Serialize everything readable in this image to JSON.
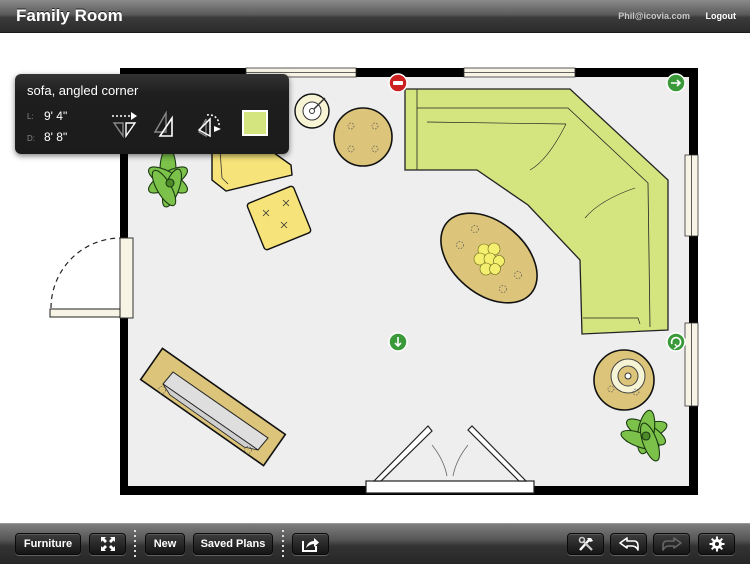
{
  "header": {
    "title": "Family Room",
    "user_email": "Phil@icovia.com",
    "logout_label": "Logout"
  },
  "selection_popup": {
    "item_name": "sofa, angled corner",
    "length_label": "L:",
    "length_value": "9' 4\"",
    "depth_label": "D:",
    "depth_value": "8' 8\"",
    "tools": [
      "flip-horizontal-icon",
      "mirror-icon",
      "rotate-icon",
      "color-swatch"
    ],
    "selected_color": "#d4e47f"
  },
  "floor_plan": {
    "room_name": "Family Room",
    "selection_handles": [
      "delete-handle",
      "resize-width-handle",
      "resize-depth-handle",
      "rotate-handle"
    ],
    "furniture": [
      {
        "name": "sofa, angled corner",
        "selected": true
      },
      {
        "name": "coffee table, oval"
      },
      {
        "name": "end table, round",
        "position": "top"
      },
      {
        "name": "end table with lamp, round",
        "position": "bottom-right"
      },
      {
        "name": "floor lamp"
      },
      {
        "name": "armchair"
      },
      {
        "name": "ottoman"
      },
      {
        "name": "plant",
        "position": "top-left"
      },
      {
        "name": "plant",
        "position": "bottom-right"
      },
      {
        "name": "tv console"
      }
    ],
    "colors": {
      "wall": "#000000",
      "floor": "#eeeeee",
      "sofa": "#d4e47f",
      "wood_table": "#dcc57a",
      "yellow_chair": "#f6e37a",
      "plant": "#7cc24a",
      "window": "#f7f4e6",
      "handle_red": "#cc1f1f",
      "handle_green": "#3a9a3a"
    }
  },
  "toolbar": {
    "furniture_label": "Furniture",
    "fullscreen_icon": "expand-arrows-icon",
    "new_label": "New",
    "saved_plans_label": "Saved Plans",
    "share_icon": "share-export-icon",
    "tools_icon": "hammer-wrench-icon",
    "undo_icon": "undo-arrow-icon",
    "redo_icon": "redo-arrow-icon",
    "settings_icon": "gear-icon"
  }
}
